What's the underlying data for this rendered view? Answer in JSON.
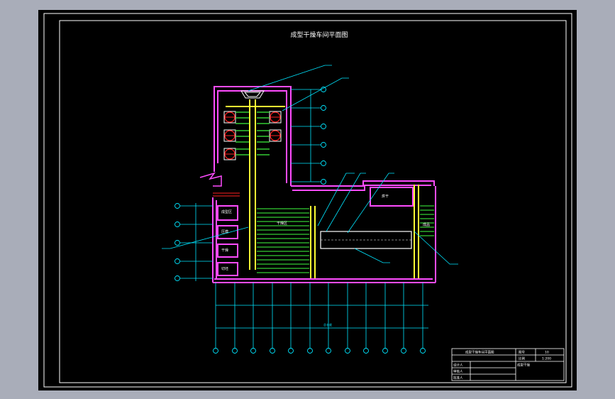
{
  "drawing": {
    "title": "成型干燥车间平面图",
    "colors": {
      "background": "#a9adb9",
      "sheet": "#000000",
      "frame": "#ffffff",
      "wall": "#ff4cff",
      "axis": "#00e5ff",
      "equipment": "#ffff33",
      "conveyor": "#33cc33",
      "red": "#ff2020",
      "text": "#ffffff"
    },
    "title_block": {
      "row1_left": "成型干燥车间平面图",
      "row1_code_label": "图号",
      "row1_code_value": "10",
      "row2_scale_label": "比例",
      "row2_scale_value": "1:200",
      "row2_right": "成型干燥",
      "row3_label": "设计人",
      "row4_label": "审核人",
      "row5_label": "批准人"
    },
    "room_labels": [
      "成型区",
      "压模",
      "干燥",
      "切坯",
      "干燥区",
      "烘干",
      "成品"
    ],
    "dimension_note": "总长度"
  }
}
